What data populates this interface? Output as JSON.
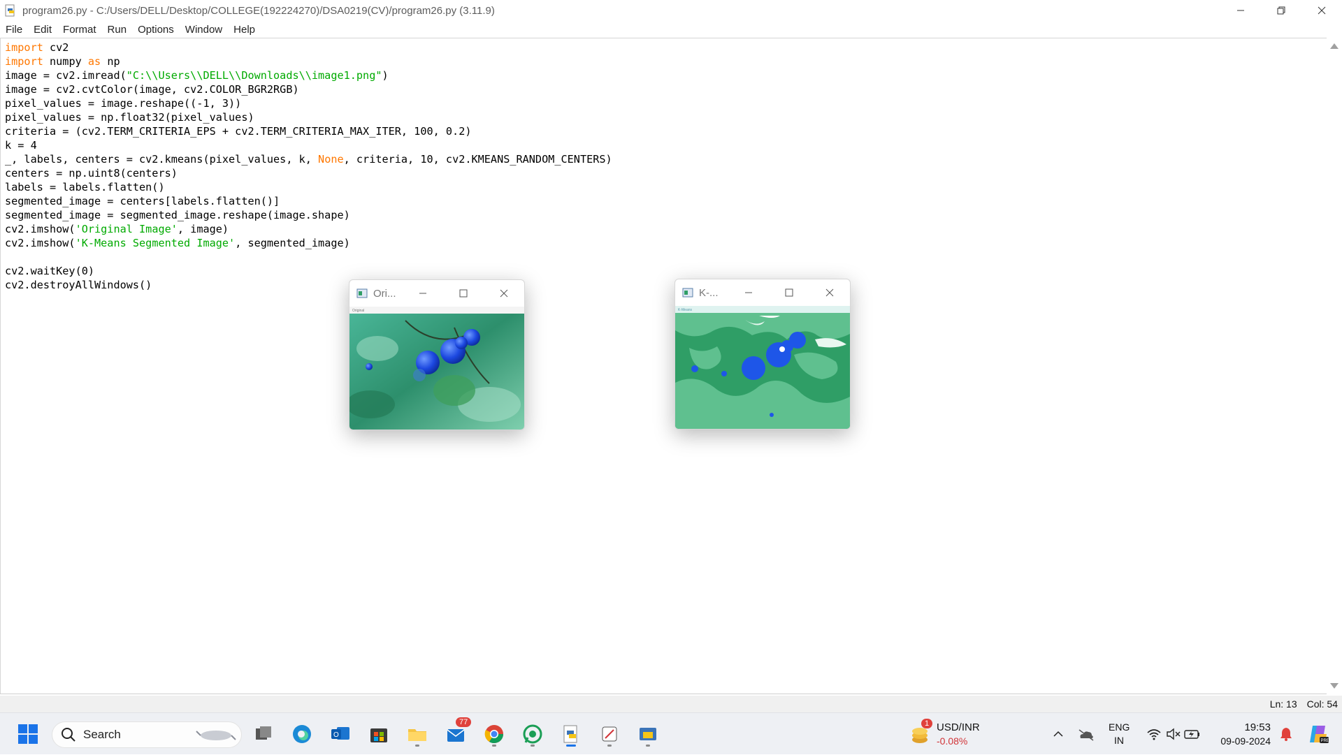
{
  "window": {
    "title": "program26.py - C:/Users/DELL/Desktop/COLLEGE(192224270)/DSA0219(CV)/program26.py (3.11.9)"
  },
  "menu": [
    "File",
    "Edit",
    "Format",
    "Run",
    "Options",
    "Window",
    "Help"
  ],
  "code_lines": [
    [
      {
        "t": "import",
        "c": "kw"
      },
      {
        "t": " cv2"
      }
    ],
    [
      {
        "t": "import",
        "c": "kw"
      },
      {
        "t": " numpy "
      },
      {
        "t": "as",
        "c": "kw"
      },
      {
        "t": " np"
      }
    ],
    [
      {
        "t": "image = cv2.imread("
      },
      {
        "t": "\"C:\\\\Users\\\\DELL\\\\Downloads\\\\image1.png\"",
        "c": "str"
      },
      {
        "t": ")"
      }
    ],
    [
      {
        "t": "image = cv2.cvtColor(image, cv2.COLOR_BGR2RGB)"
      }
    ],
    [
      {
        "t": "pixel_values = image.reshape((-1, 3))"
      }
    ],
    [
      {
        "t": "pixel_values = np.float32(pixel_values)"
      }
    ],
    [
      {
        "t": "criteria = (cv2.TERM_CRITERIA_EPS + cv2.TERM_CRITERIA_MAX_ITER, 100, 0.2)"
      }
    ],
    [
      {
        "t": "k = 4"
      }
    ],
    [
      {
        "t": "_, labels, centers = cv2.kmeans(pixel_values, k, "
      },
      {
        "t": "None",
        "c": "kw"
      },
      {
        "t": ", criteria, 10, cv2.KMEANS_RANDOM_CENTERS)"
      }
    ],
    [
      {
        "t": "centers = np.uint8(centers)"
      }
    ],
    [
      {
        "t": "labels = labels.flatten()"
      }
    ],
    [
      {
        "t": "segmented_image = centers[labels.flatten()]"
      }
    ],
    [
      {
        "t": "segmented_image = segmented_image.reshape(image.shape)"
      }
    ],
    [
      {
        "t": "cv2.imshow("
      },
      {
        "t": "'Original Image'",
        "c": "str"
      },
      {
        "t": ", image)"
      }
    ],
    [
      {
        "t": "cv2.imshow("
      },
      {
        "t": "'K-Means Segmented Image'",
        "c": "str"
      },
      {
        "t": ", segmented_image)"
      }
    ],
    [
      {
        "t": ""
      }
    ],
    [
      {
        "t": "cv2.waitKey(0)"
      }
    ],
    [
      {
        "t": "cv2.destroyAllWindows()"
      }
    ]
  ],
  "cv_windows": {
    "original": {
      "title": "Ori...",
      "inner_caption": "Original"
    },
    "kmeans": {
      "title": "K-...",
      "inner_caption": "K-Means"
    }
  },
  "status": {
    "line": "Ln: 13",
    "col": "Col: 54"
  },
  "taskbar": {
    "search_label": "Search",
    "mail_badge": "77",
    "widget": {
      "badge": "1",
      "title": "USD/INR",
      "value": "-0.08%"
    },
    "lang": {
      "line1": "ENG",
      "line2": "IN"
    },
    "clock": {
      "time": "19:53",
      "date": "09-09-2024"
    }
  },
  "colors": {
    "keyword": "#ff7700",
    "string": "#00aa00",
    "seg_green": "#2f9e66",
    "seg_light": "#5fc08f",
    "seg_blue": "#1e56e8",
    "market_down": "#d13438"
  }
}
